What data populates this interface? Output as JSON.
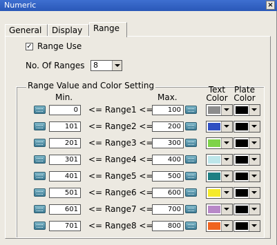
{
  "window": {
    "title": "Numeric",
    "close_label": "×"
  },
  "tabs": [
    {
      "label": "General"
    },
    {
      "label": "Display"
    },
    {
      "label": "Range",
      "active": true
    }
  ],
  "range_use": {
    "label": "Range Use",
    "checked": true,
    "mark": "✓"
  },
  "num_ranges": {
    "label": "No. Of Ranges",
    "value": "8"
  },
  "group": {
    "title": "Range Value and Color Setting",
    "min_label": "Min.",
    "max_label": "Max.",
    "text_color_label_1": "Text",
    "text_color_label_2": "Color",
    "plate_color_label_1": "Plate",
    "plate_color_label_2": "Color"
  },
  "rows": [
    {
      "min": "0",
      "range": "<= Range1 <=",
      "max": "100",
      "text_color": "#8c8c8c",
      "plate_color": "#000000"
    },
    {
      "min": "101",
      "range": "<= Range2 <=",
      "max": "200",
      "text_color": "#2f4fc2",
      "plate_color": "#000000"
    },
    {
      "min": "201",
      "range": "<= Range3 <=",
      "max": "300",
      "text_color": "#7fd34a",
      "plate_color": "#000000"
    },
    {
      "min": "301",
      "range": "<= Range4 <=",
      "max": "400",
      "text_color": "#bde6ea",
      "plate_color": "#000000"
    },
    {
      "min": "401",
      "range": "<= Range5 <=",
      "max": "500",
      "text_color": "#1e7f83",
      "plate_color": "#000000"
    },
    {
      "min": "501",
      "range": "<= Range6 <=",
      "max": "600",
      "text_color": "#f5ea2a",
      "plate_color": "#000000"
    },
    {
      "min": "601",
      "range": "<= Range7 <=",
      "max": "700",
      "text_color": "#b888c8",
      "plate_color": "#000000"
    },
    {
      "min": "701",
      "range": "<= Range8 <=",
      "max": "800",
      "text_color": "#f0641f",
      "plate_color": "#000000"
    }
  ]
}
